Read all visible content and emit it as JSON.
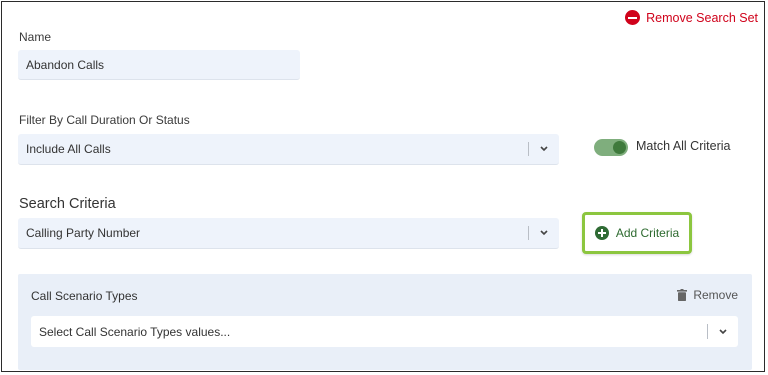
{
  "header": {
    "remove_search_set": "Remove Search Set"
  },
  "name_section": {
    "label": "Name",
    "value": "Abandon Calls"
  },
  "filter_section": {
    "label": "Filter By Call Duration Or Status",
    "selected": "Include All Calls",
    "toggle_on": true,
    "toggle_label": "Match All Criteria"
  },
  "criteria_section": {
    "label": "Search Criteria",
    "selected": "Calling Party Number",
    "add_button": "Add Criteria"
  },
  "panel": {
    "title": "Call Scenario Types",
    "remove": "Remove",
    "placeholder": "Select Call Scenario Types values..."
  },
  "colors": {
    "danger": "#d0021b",
    "accent_green": "#3f7a3c",
    "highlight_border": "#8cc63f",
    "field_bg": "#eef3fb",
    "panel_bg": "#e9eff8"
  }
}
